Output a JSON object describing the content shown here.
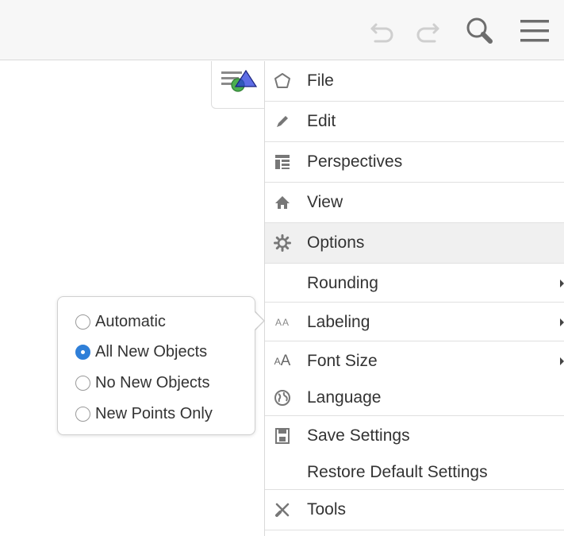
{
  "toolbar": {
    "icons": [
      "undo-icon",
      "redo-icon",
      "search-icon",
      "menu-icon"
    ]
  },
  "perspectives_button": {
    "icon": "perspectives-toggle-icon"
  },
  "menu": {
    "items": [
      {
        "label": "File",
        "icon": "file-icon"
      },
      {
        "label": "Edit",
        "icon": "pencil-icon"
      },
      {
        "label": "Perspectives",
        "icon": "perspectives-icon"
      },
      {
        "label": "View",
        "icon": "home-icon"
      },
      {
        "label": "Options",
        "icon": "gear-icon"
      }
    ],
    "options_submenu": [
      {
        "label": "Rounding",
        "icon": "",
        "has_submenu": true
      },
      {
        "label": "Labeling",
        "icon": "small-caps-icon",
        "has_submenu": true
      },
      {
        "label": "Font Size",
        "icon": "font-size-icon",
        "has_submenu": true
      },
      {
        "label": "Language",
        "icon": "globe-icon",
        "has_submenu": false
      },
      {
        "label": "Save Settings",
        "icon": "save-icon",
        "has_submenu": false
      },
      {
        "label": "Restore Default Settings",
        "icon": "",
        "has_submenu": false
      }
    ],
    "tools": {
      "label": "Tools",
      "icon": "tools-icon"
    }
  },
  "labeling_popup": {
    "options": [
      {
        "label": "Automatic",
        "checked": false
      },
      {
        "label": "All New Objects",
        "checked": true
      },
      {
        "label": "No New Objects",
        "checked": false
      },
      {
        "label": "New Points Only",
        "checked": false
      }
    ]
  },
  "colors": {
    "accent": "#2f7fd8",
    "toolbar_bg": "#f7f7f7",
    "active_row_bg": "#f0f0f0",
    "text": "#333333",
    "icon": "#777777"
  }
}
